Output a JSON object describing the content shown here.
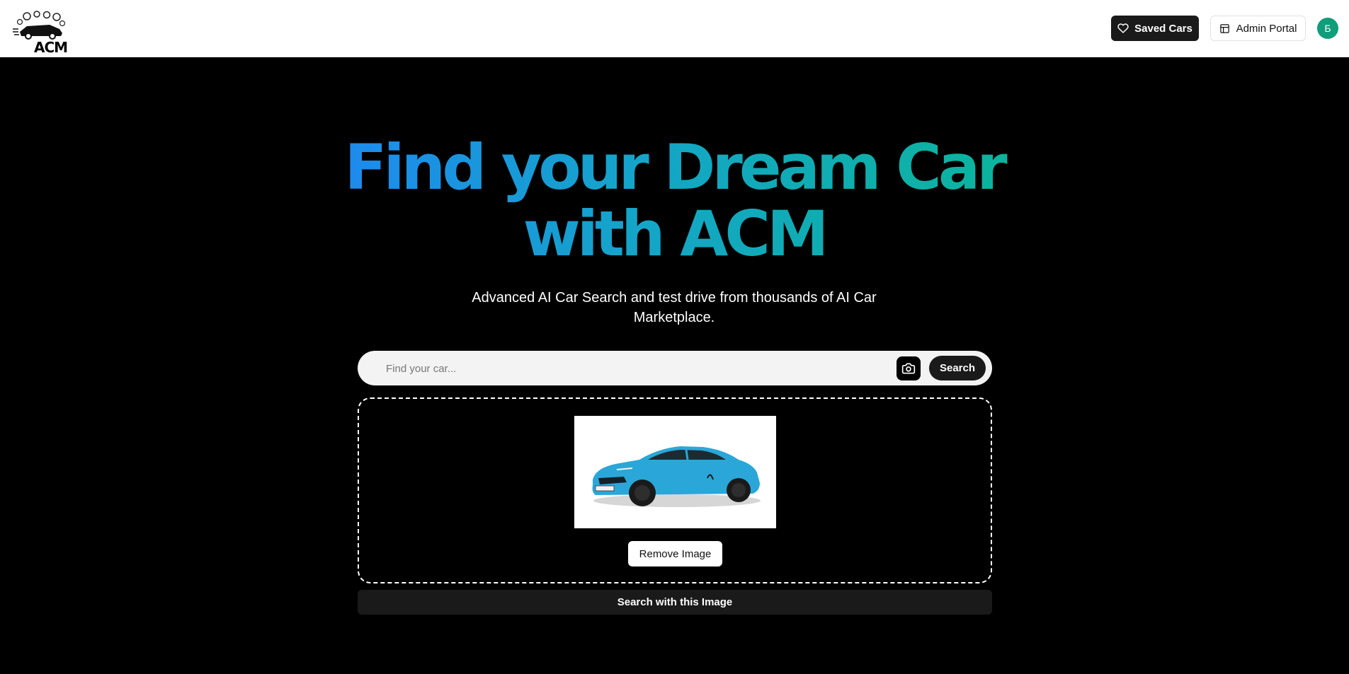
{
  "header": {
    "logo_text": "ACM",
    "saved_cars_label": "Saved Cars",
    "admin_portal_label": "Admin Portal",
    "avatar_initial": "Б"
  },
  "hero": {
    "title_line1": "Find your Dream Car",
    "title_line2": "with ACM",
    "subtitle": "Advanced AI Car Search and test drive from thousands of AI Car Marketplace."
  },
  "search": {
    "placeholder": "Find your car...",
    "value": "",
    "button_label": "Search"
  },
  "upload": {
    "remove_label": "Remove Image",
    "search_image_label": "Search with this Image"
  },
  "colors": {
    "gradient_start": "#1e88f0",
    "gradient_end": "#0bb59a",
    "avatar_bg": "#0f9d7a",
    "car_body": "#2aa7d8"
  },
  "icons": {
    "saved_cars": "heart-icon",
    "admin_portal": "layout-icon",
    "camera": "camera-icon"
  }
}
